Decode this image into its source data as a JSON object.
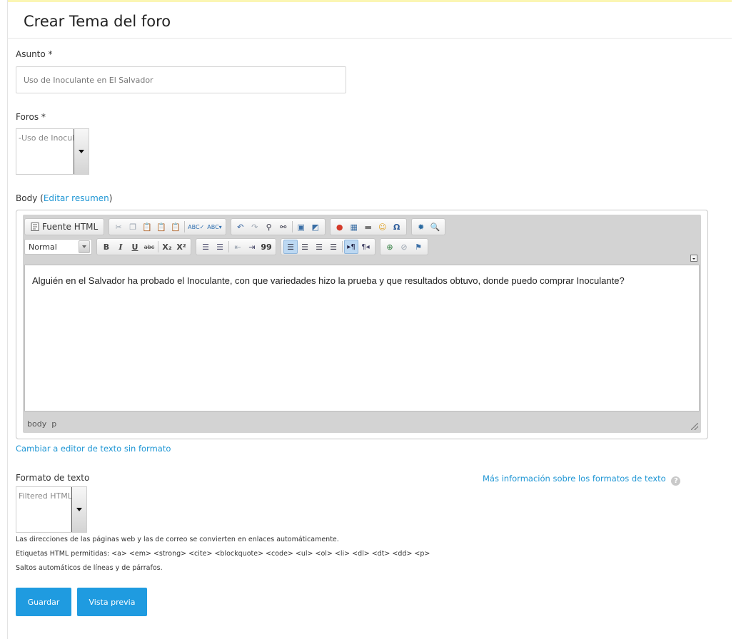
{
  "page": {
    "title": "Crear Tema del foro"
  },
  "asunto": {
    "label": "Asunto *",
    "value": "Uso de Inoculante en El Salvador"
  },
  "foros": {
    "label": "Foros *",
    "selected": "-Uso de Inoculante"
  },
  "body": {
    "label": "Body",
    "label_open": "(",
    "edit_summary_link": "Editar resumen",
    "label_close": ")",
    "toolbar": {
      "source_label": "Fuente HTML",
      "format_value": "Normal",
      "bold": "B",
      "italic": "I",
      "underline": "U",
      "strike": "abc",
      "subscript": "X₂",
      "superscript": "X²",
      "blockquote": "99"
    },
    "content": "Alguién en el Salvador ha probado el Inoculante, con que variedades hizo la prueba y que resultados obtuvo, donde puedo comprar Inoculante?",
    "status_path": [
      "body",
      "p"
    ]
  },
  "switch_editor_link": "Cambiar a editor de texto sin formato",
  "text_format": {
    "label": "Formato de texto",
    "selected": "Filtered HTML",
    "more_info_link": "Más información sobre los formatos de texto",
    "help_icon": "?",
    "tips": [
      "Las direcciones de las páginas web y las de correo se convierten en enlaces automáticamente.",
      "Etiquetas HTML permitidas: <a> <em> <strong> <cite> <blockquote> <code> <ul> <ol> <li> <dl> <dt> <dd> <p>",
      "Saltos automáticos de líneas y de párrafos."
    ]
  },
  "actions": {
    "save": "Guardar",
    "preview": "Vista previa"
  },
  "colors": {
    "accent": "#1f9be0",
    "link": "#1f96d4"
  }
}
